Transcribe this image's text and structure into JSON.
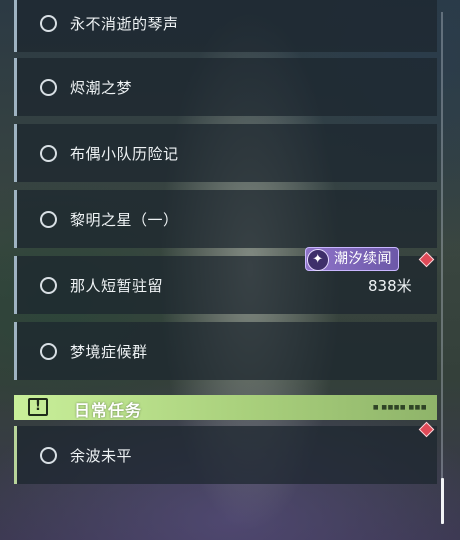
{
  "quests": [
    {
      "label": "永不消逝的琴声"
    },
    {
      "label": "烬潮之梦"
    },
    {
      "label": "布偶小队历险记"
    },
    {
      "label": "黎明之星（一）"
    },
    {
      "label": "那人短暂驻留"
    },
    {
      "label": "梦境症候群"
    }
  ],
  "tracked": {
    "badge_label": "潮汐续闻",
    "badge_icon": "tide-emblem-icon",
    "distance": "838米"
  },
  "daily_section": {
    "title": "日常任务",
    "icon": "exclamation-icon",
    "tag": "■ ■■■■ ■■■",
    "quests": [
      {
        "label": "余波未平"
      }
    ]
  },
  "colors": {
    "section_accent": "#c9ef9a",
    "badge": "#8f74c9",
    "marker": "#e04a58"
  }
}
